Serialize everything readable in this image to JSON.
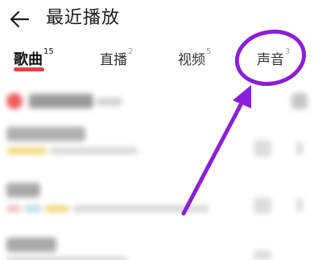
{
  "header": {
    "title": "最近播放"
  },
  "tabs": [
    {
      "label": "歌曲",
      "count": "15",
      "active": true
    },
    {
      "label": "直播",
      "count": "2",
      "active": false
    },
    {
      "label": "视频",
      "count": "5",
      "active": false
    },
    {
      "label": "声音",
      "count": "3",
      "active": false
    }
  ],
  "colors": {
    "accent_red": "#e0424a",
    "annotation_purple": "#8a1fd6"
  },
  "icons": {
    "back": "arrow-left-icon"
  }
}
